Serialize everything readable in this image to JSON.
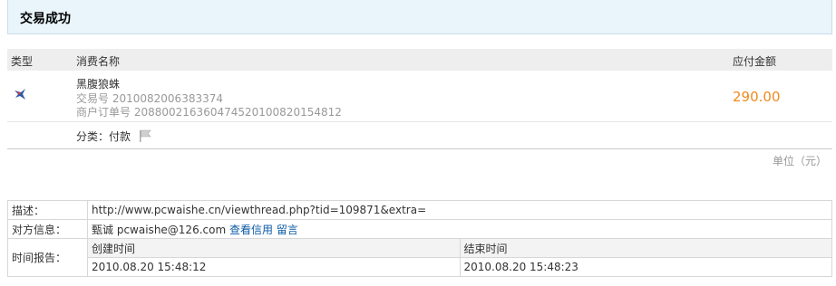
{
  "header": {
    "title": "交易成功"
  },
  "tx_table": {
    "columns": {
      "type": "类型",
      "name": "消费名称",
      "amount": "应付金额"
    },
    "item": {
      "type_icon": "bird-icon",
      "name": "黑腹狼蛛",
      "trade_no_label": "交易号",
      "trade_no": "2010082006383374",
      "order_no_label": "商户订单号",
      "order_no": "2088002163604745201008201548​12",
      "amount": "290.00",
      "category_label": "分类：",
      "category_value": "付款",
      "category_icon": "flag-icon"
    },
    "unit": "单位（元）"
  },
  "detail": {
    "desc_label": "描述：",
    "desc_value": "http://www.pcwaishe.cn/viewthread.php?tid=109871&extra=",
    "party_label": "对方信息：",
    "party_name": "甄诚",
    "party_email": "pcwaishe@126.com",
    "check_credit": "查看信用",
    "message": "留言",
    "time_label": "时间报告：",
    "created_label": "创建时间",
    "ended_label": "结束时间",
    "created_value": "2010.08.20 15:48:12",
    "ended_value": "2010.08.20 15:48:23"
  },
  "colors": {
    "accent_amount": "#f08a1c",
    "link": "#0b5aa6",
    "header_bg": "#e9f4fb"
  }
}
